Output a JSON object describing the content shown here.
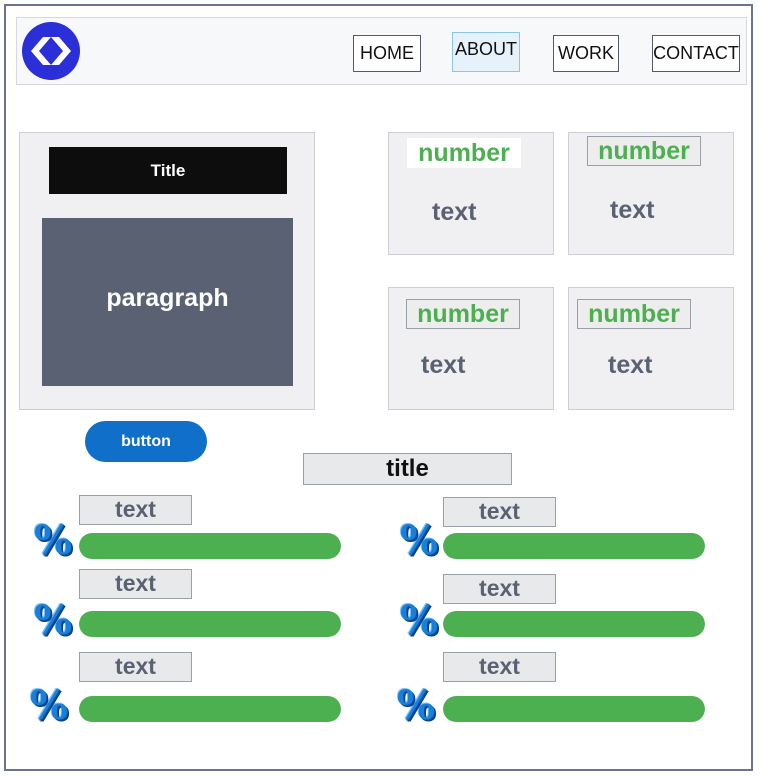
{
  "nav": {
    "items": [
      {
        "label": "HOME",
        "active": false
      },
      {
        "label": "ABOUT",
        "active": true
      },
      {
        "label": "WORK",
        "active": false
      },
      {
        "label": "CONTACT",
        "active": false
      }
    ]
  },
  "intro": {
    "title": "Title",
    "paragraph": "paragraph",
    "button_label": "button"
  },
  "stats": [
    {
      "number": "number",
      "text": "text"
    },
    {
      "number": "number",
      "text": "text"
    },
    {
      "number": "number",
      "text": "text"
    },
    {
      "number": "number",
      "text": "text"
    }
  ],
  "skills": {
    "title": "title",
    "percent_icon": "percent-icon",
    "items": [
      {
        "label": "text",
        "level": 1.0
      },
      {
        "label": "text",
        "level": 1.0
      },
      {
        "label": "text",
        "level": 1.0
      },
      {
        "label": "text",
        "level": 1.0
      },
      {
        "label": "text",
        "level": 1.0
      },
      {
        "label": "text",
        "level": 1.0
      }
    ]
  },
  "colors": {
    "accent_green": "#4caf50",
    "button_blue": "#0f6fc9",
    "logo_blue": "#2a2fd8",
    "panel_dark": "#5a6172"
  }
}
